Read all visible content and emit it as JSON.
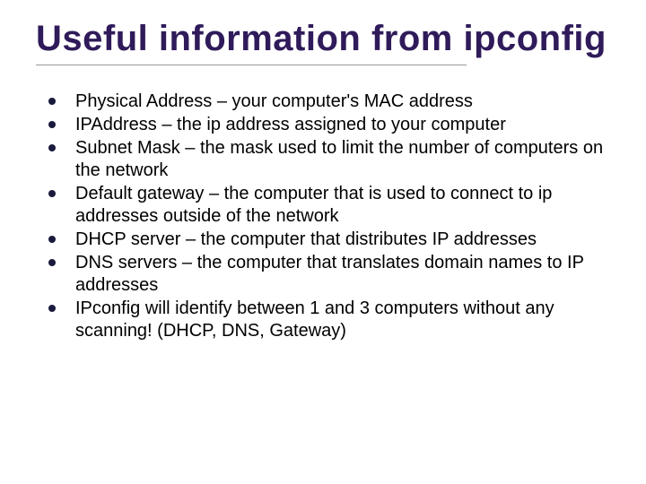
{
  "title": "Useful information from ipconfig",
  "bullets": [
    "Physical Address – your computer's MAC address",
    "IPAddress – the ip address assigned to your computer",
    "Subnet Mask – the mask used to limit the number of computers on the network",
    "Default gateway – the computer that is used to connect to ip addresses outside of the network",
    "DHCP server – the computer that distributes IP addresses",
    "DNS servers – the computer that translates domain names to IP addresses",
    "IPconfig will identify between 1 and 3 computers without any scanning! (DHCP, DNS, Gateway)"
  ]
}
